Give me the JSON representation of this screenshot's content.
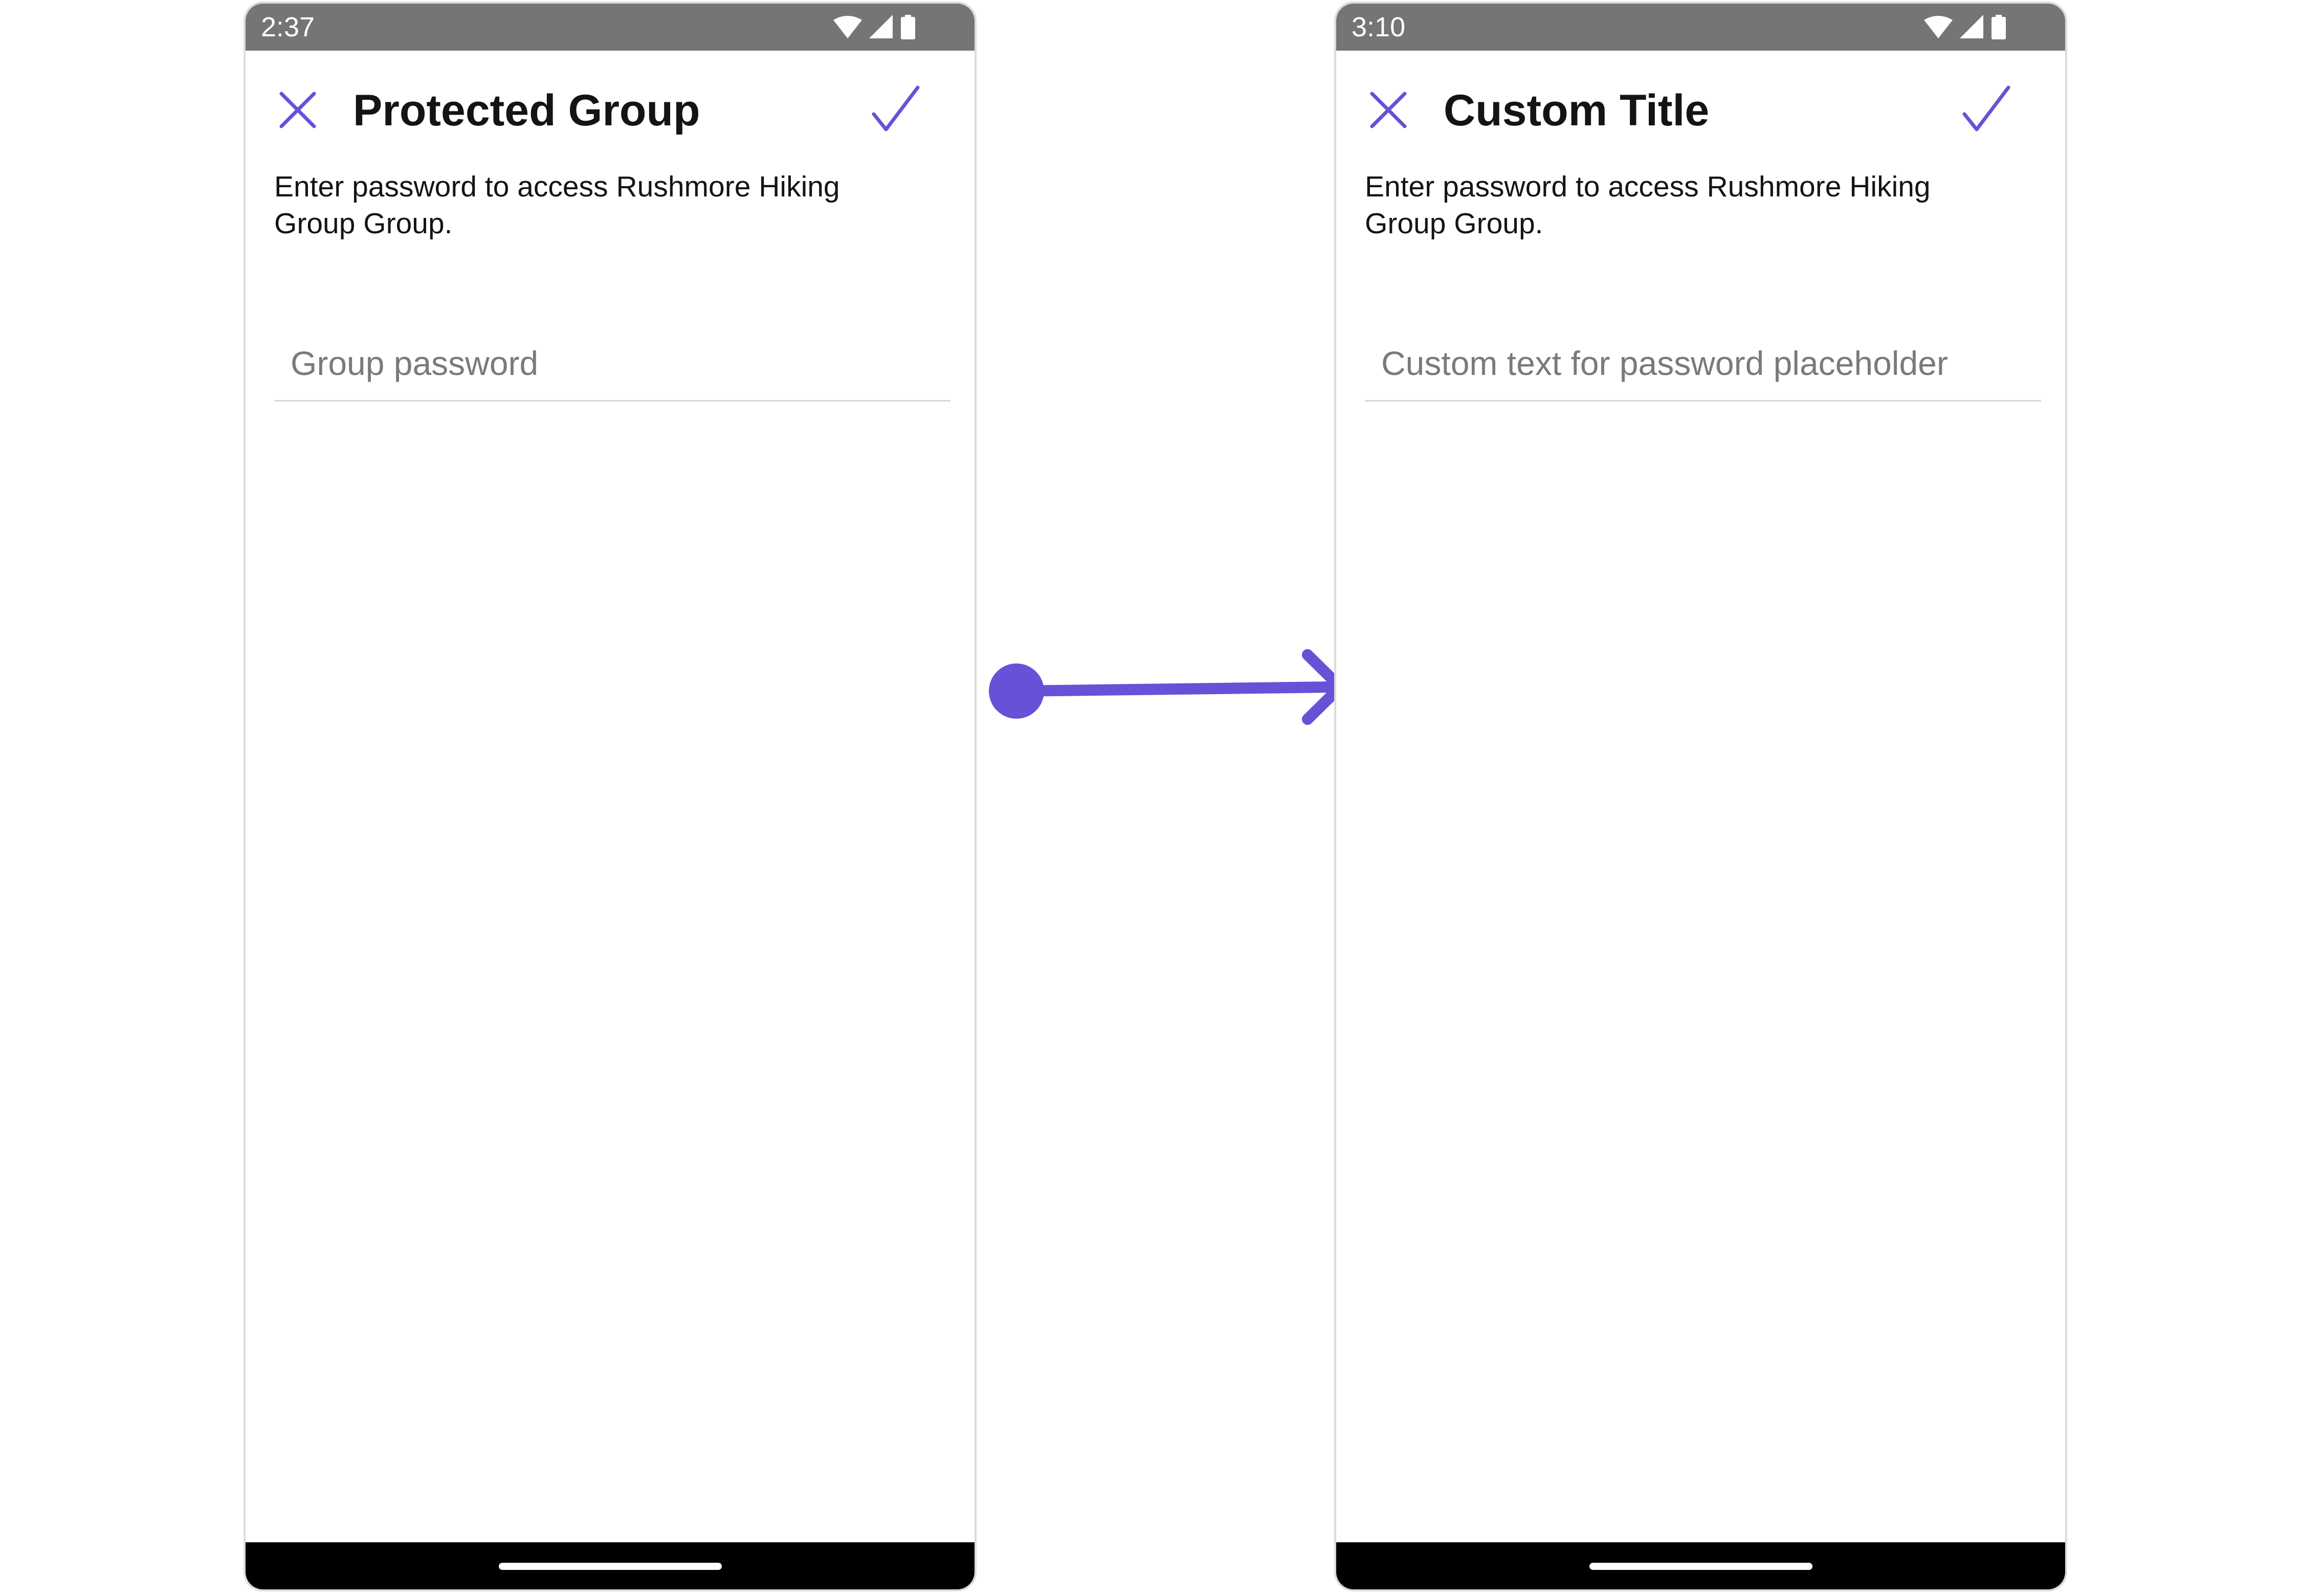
{
  "screens": [
    {
      "status_time": "2:37",
      "title": "Protected Group",
      "description": "Enter password to access Rushmore Hiking Group Group.",
      "password_placeholder": "Group password"
    },
    {
      "status_time": "3:10",
      "title": "Custom Title",
      "description": "Enter password to access Rushmore Hiking Group Group.",
      "password_placeholder": "Custom text for password placeholder"
    }
  ],
  "icons": {
    "close": "close-icon",
    "confirm": "checkmark-icon",
    "status": [
      "wifi-icon",
      "cell-signal-icon",
      "battery-icon"
    ],
    "transition": "arrow-right-icon"
  },
  "colors": {
    "accent": "#6851D6",
    "status_bar": "#757575",
    "nav_bar": "#000000",
    "text": "#141414",
    "placeholder": "#7A7A7A",
    "divider": "#D8D8D8"
  }
}
